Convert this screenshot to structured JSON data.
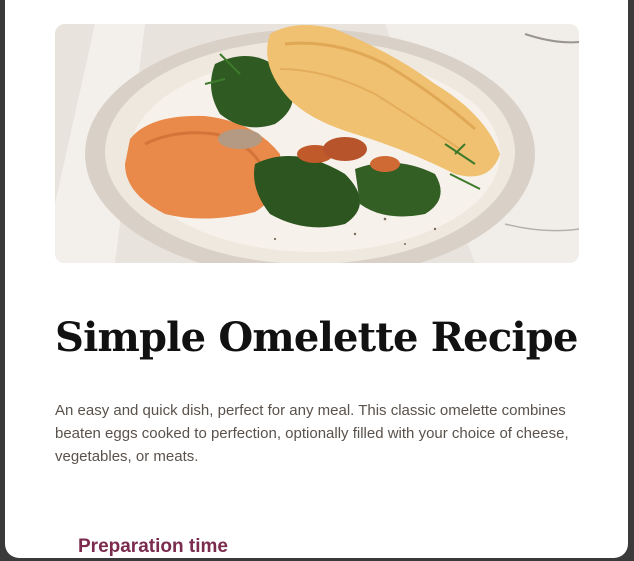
{
  "recipe": {
    "image_name": "omelette-photo",
    "title": "Simple Omelette Recipe",
    "description": "An easy and quick dish, perfect for any meal. This classic omelette combines beaten eggs cooked to perfection, optionally filled with your choice of cheese, vegetables, or meats."
  },
  "preparation": {
    "heading": "Preparation time"
  },
  "colors": {
    "title": "#111111",
    "body_text": "#5a524c",
    "accent": "#7a2b4e",
    "card_background": "#ffffff"
  }
}
